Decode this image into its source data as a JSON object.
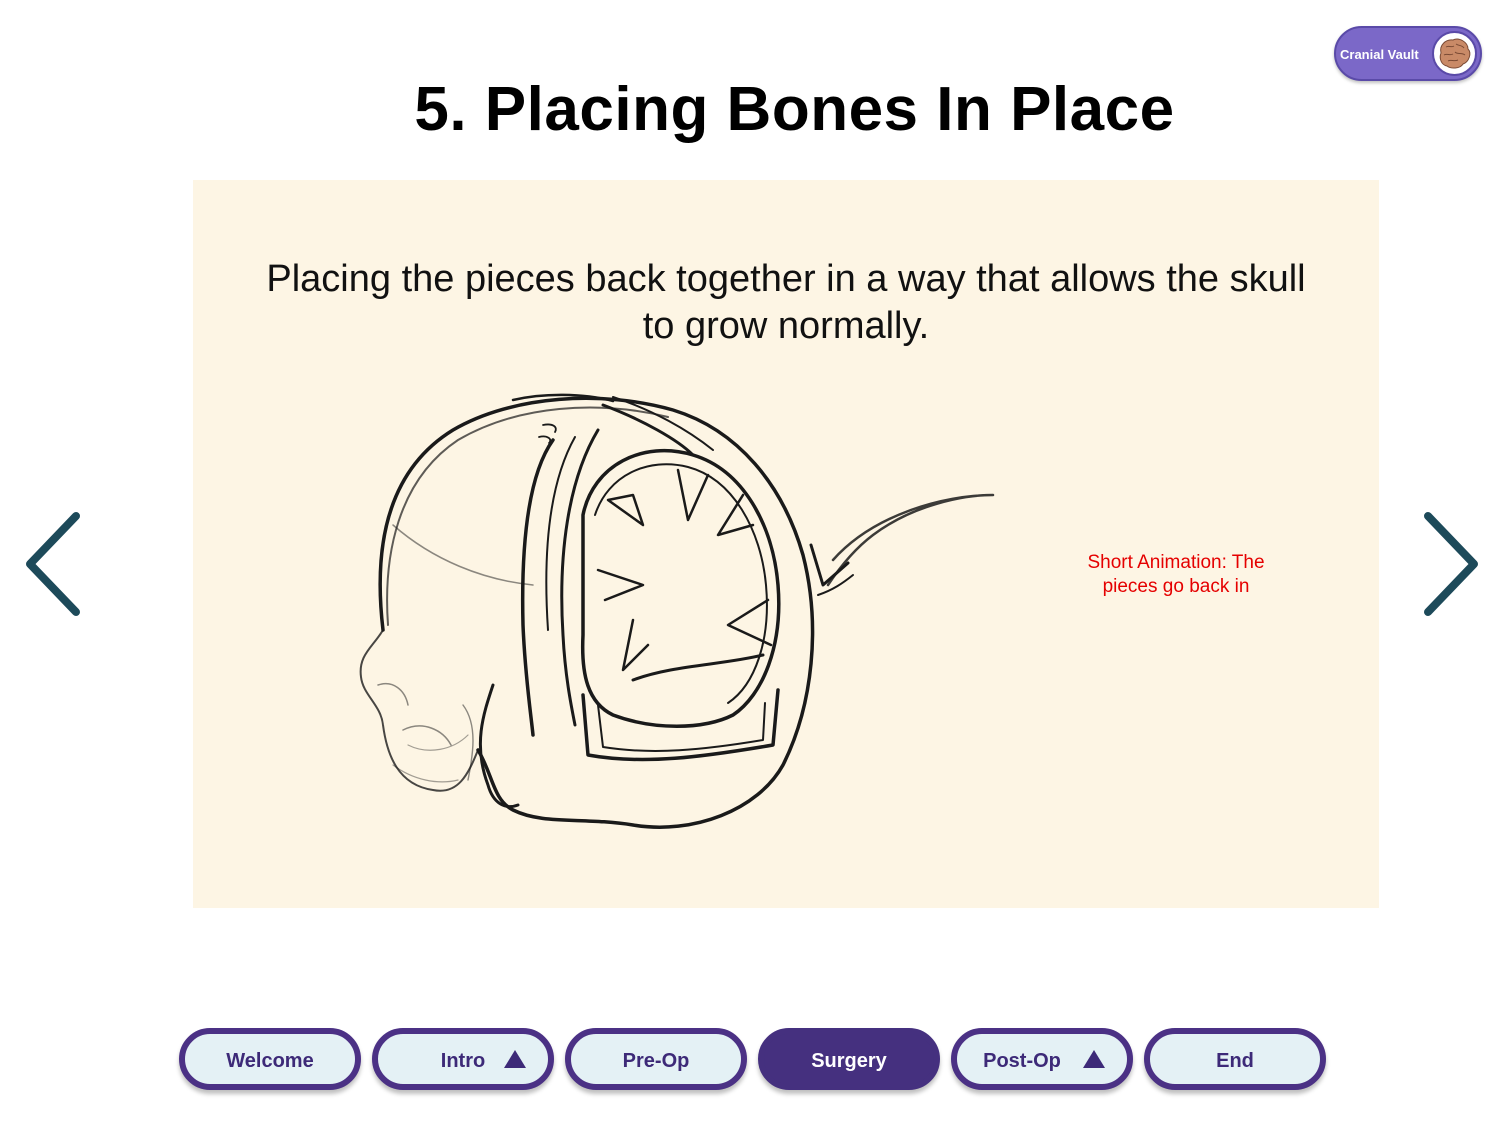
{
  "header": {
    "title": "5. Placing Bones In Place",
    "badge": {
      "label": "Cranial Vault",
      "avatar_icon": "brain-avatar-icon"
    }
  },
  "content": {
    "caption": "Placing the pieces back together in a way that allows the skull to grow normally.",
    "note": "Short Animation: The pieces go back in",
    "illustration": "skull-sketch-icon"
  },
  "navigation": {
    "prev_icon": "chevron-left-icon",
    "next_icon": "chevron-right-icon",
    "arrow_color": "#1d4a5a"
  },
  "tabs": [
    {
      "label": "Welcome",
      "active": false,
      "caret": false
    },
    {
      "label": "Intro",
      "active": false,
      "caret": true
    },
    {
      "label": "Pre-Op",
      "active": false,
      "caret": false
    },
    {
      "label": "Surgery",
      "active": true,
      "caret": false
    },
    {
      "label": "Post-Op",
      "active": false,
      "caret": true
    },
    {
      "label": "End",
      "active": false,
      "caret": false
    }
  ],
  "colors": {
    "panel_background": "#fdf5e4",
    "tab_active": "#45307f",
    "tab_inactive_fill": "#e4f1f5",
    "badge": "#7b68c8",
    "note_text": "#e50000"
  }
}
